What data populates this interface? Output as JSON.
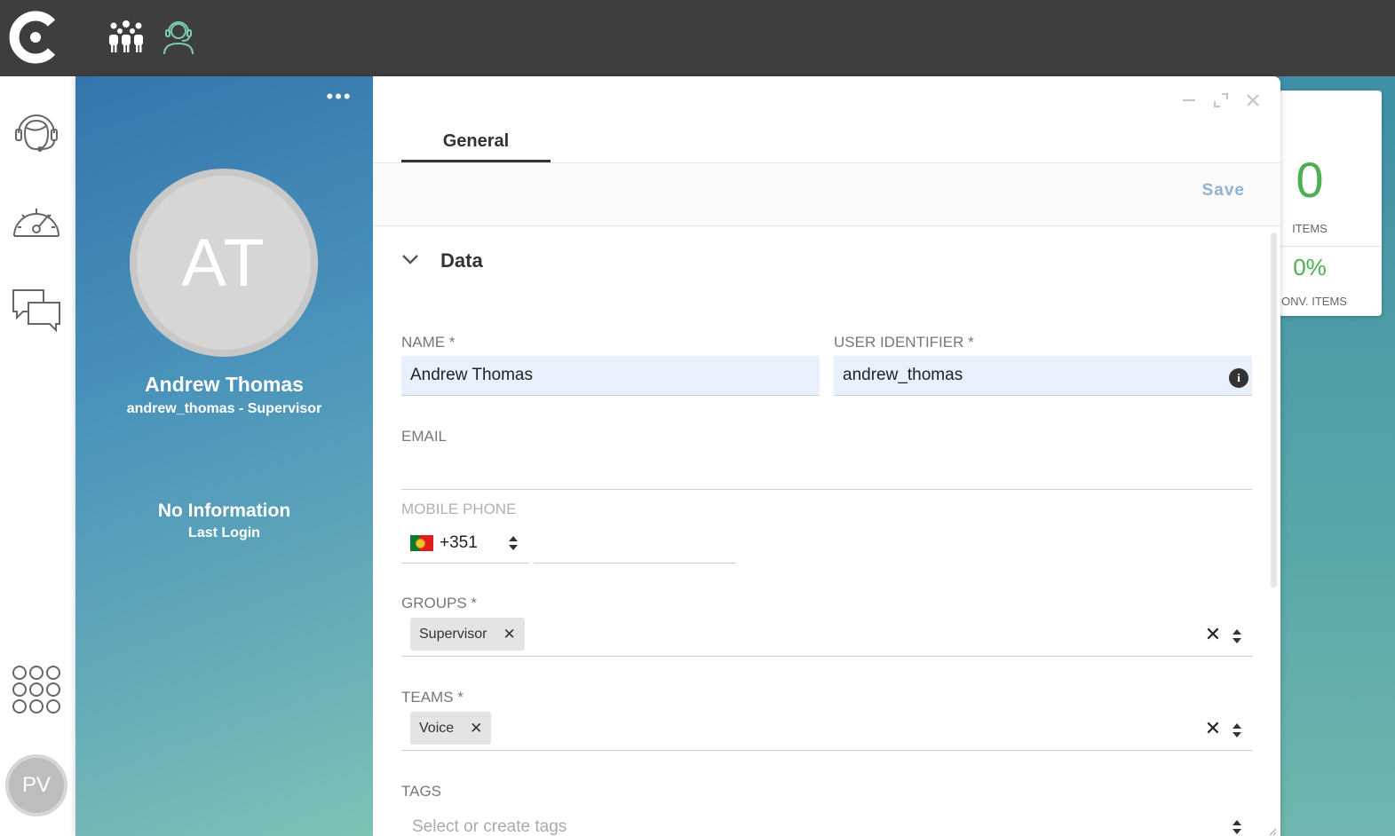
{
  "app": {
    "logo_icon": "c-logo-icon",
    "top_icons": [
      "team-icon",
      "agent-headset-icon"
    ],
    "accent_color": "#4caf50"
  },
  "nav": {
    "items": [
      "headset-icon",
      "dashboard-gauge-icon",
      "chat-icon"
    ],
    "apps_icon": "apps-grid-icon",
    "user_initials": "PV"
  },
  "stats": {
    "count": "0",
    "count_label": "ITEMS",
    "percent": "0%",
    "percent_label": "ONV. ITEMS"
  },
  "profile": {
    "initials": "AT",
    "name": "Andrew Thomas",
    "subtitle": "andrew_thomas - Supervisor",
    "last_login_value": "No Information",
    "last_login_label": "Last Login",
    "menu": "•••"
  },
  "tabs": [
    {
      "label": "General"
    }
  ],
  "toolbar": {
    "save_label": "Save"
  },
  "section": {
    "title": "Data"
  },
  "form": {
    "name_label": "NAME *",
    "name_value": "Andrew Thomas",
    "user_id_label": "USER IDENTIFIER *",
    "user_id_value": "andrew_thomas",
    "email_label": "EMAIL",
    "email_value": "",
    "mobile_label": "MOBILE PHONE",
    "phone_code": "+351",
    "phone_value": "",
    "groups_label": "GROUPS *",
    "groups": [
      "Supervisor"
    ],
    "teams_label": "TEAMS *",
    "teams": [
      "Voice"
    ],
    "tags_label": "TAGS",
    "tags_placeholder": "Select or create tags"
  }
}
